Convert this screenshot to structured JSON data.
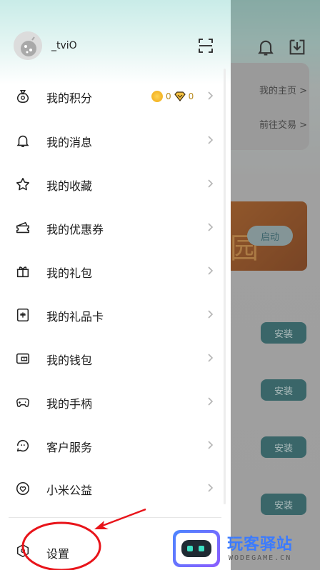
{
  "background": {
    "links": [
      "我的主页 >",
      "前往交易 >"
    ],
    "launch_label": "启动",
    "install_label": "安装"
  },
  "drawer": {
    "username": "_tviO",
    "menu": [
      {
        "label": "我的积分",
        "icon": "money-bag-icon",
        "points_coin": "0",
        "points_diamond": "0"
      },
      {
        "label": "我的消息",
        "icon": "bell-icon"
      },
      {
        "label": "我的收藏",
        "icon": "star-icon"
      },
      {
        "label": "我的优惠券",
        "icon": "coupon-icon"
      },
      {
        "label": "我的礼包",
        "icon": "gift-icon"
      },
      {
        "label": "我的礼品卡",
        "icon": "gift-card-icon"
      },
      {
        "label": "我的钱包",
        "icon": "wallet-icon"
      },
      {
        "label": "我的手柄",
        "icon": "gamepad-icon"
      },
      {
        "label": "客户服务",
        "icon": "customer-service-icon"
      },
      {
        "label": "小米公益",
        "icon": "heart-icon"
      }
    ],
    "settings_label": "设置"
  },
  "watermark": {
    "title": "玩客驿站",
    "subtitle": "WODEGAME.CN"
  },
  "colors": {
    "accent_teal": "#2a6d72",
    "annotation_red": "#e8141a",
    "coin_gold": "#f0a91c"
  }
}
